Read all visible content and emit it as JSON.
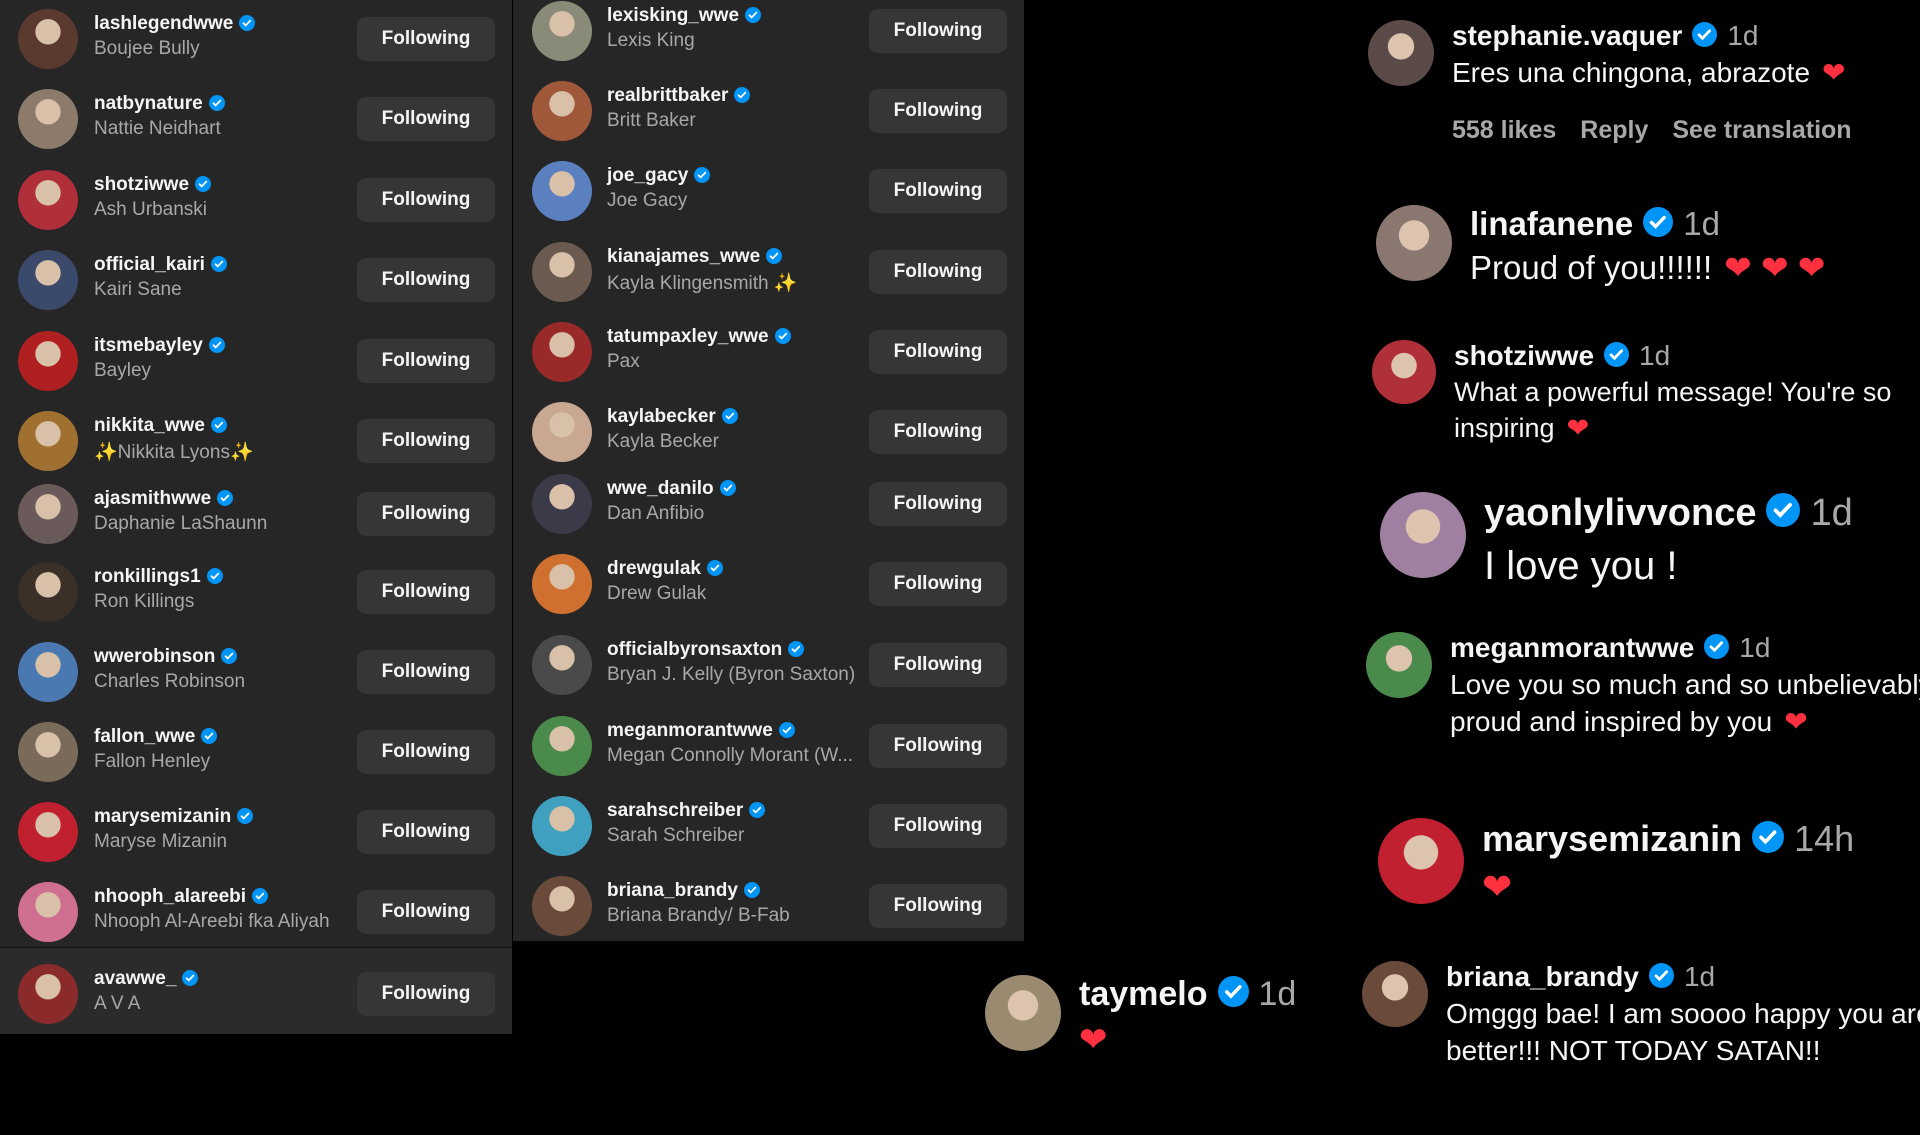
{
  "following_list_1": [
    {
      "username": "lashlegendwwe",
      "name": "Boujee Bully",
      "button": "Following",
      "color": "#5a3a2e"
    },
    {
      "username": "natbynature",
      "name": "Nattie Neidhart",
      "button": "Following",
      "color": "#8c7a6a"
    },
    {
      "username": "shotziwwe",
      "name": "Ash Urbanski",
      "button": "Following",
      "color": "#b0303a"
    },
    {
      "username": "official_kairi",
      "name": "Kairi Sane",
      "button": "Following",
      "color": "#3b4a6a"
    },
    {
      "username": "itsmebayley",
      "name": "Bayley",
      "button": "Following",
      "color": "#b02020"
    },
    {
      "username": "nikkita_wwe",
      "name": "✨Nikkita Lyons✨",
      "button": "Following",
      "color": "#a07030"
    },
    {
      "username": "ajasmithwwe",
      "name": "Daphanie LaShaunn",
      "button": "Following",
      "color": "#6a5a5a"
    },
    {
      "username": "ronkillings1",
      "name": "Ron Killings",
      "button": "Following",
      "color": "#3a3028"
    },
    {
      "username": "wwerobinson",
      "name": "Charles Robinson",
      "button": "Following",
      "color": "#4a78b0"
    },
    {
      "username": "fallon_wwe",
      "name": "Fallon Henley",
      "button": "Following",
      "color": "#7a6a5a"
    },
    {
      "username": "marysemizanin",
      "name": "Maryse Mizanin",
      "button": "Following",
      "color": "#c02030"
    },
    {
      "username": "nhooph_alareebi",
      "name": "Nhooph Al-Areebi fka Aliyah",
      "button": "Following",
      "color": "#d07090"
    },
    {
      "username": "avawwe_",
      "name": "A V A",
      "button": "Following",
      "color": "#8a2a2a"
    }
  ],
  "following_list_2": [
    {
      "username": "lexisking_wwe",
      "name": "Lexis King",
      "button": "Following",
      "color": "#8a8a78"
    },
    {
      "username": "realbrittbaker",
      "name": "Britt Baker",
      "button": "Following",
      "color": "#a0583a"
    },
    {
      "username": "joe_gacy",
      "name": "Joe Gacy",
      "button": "Following",
      "color": "#5a80c0"
    },
    {
      "username": "kianajames_wwe",
      "name": "Kayla Klingensmith ✨",
      "button": "Following",
      "color": "#6a5a50"
    },
    {
      "username": "tatumpaxley_wwe",
      "name": "Pax",
      "button": "Following",
      "color": "#9a2a2a"
    },
    {
      "username": "kaylabecker",
      "name": "Kayla Becker",
      "button": "Following",
      "color": "#c8a890"
    },
    {
      "username": "wwe_danilo",
      "name": "Dan Anfibio",
      "button": "Following",
      "color": "#3a3a48"
    },
    {
      "username": "drewgulak",
      "name": "Drew Gulak",
      "button": "Following",
      "color": "#d07030"
    },
    {
      "username": "officialbyronsaxton",
      "name": "Bryan J. Kelly (Byron Saxton)",
      "button": "Following",
      "color": "#4a4a4a"
    },
    {
      "username": "meganmorantwwe",
      "name": "Megan Connolly Morant (W...",
      "button": "Following",
      "color": "#4a8a4a"
    },
    {
      "username": "sarahschreiber",
      "name": "Sarah Schreiber",
      "button": "Following",
      "color": "#40a0c0"
    },
    {
      "username": "briana_brandy",
      "name": "Briana Brandy/ B-Fab",
      "button": "Following",
      "color": "#6a4a3a"
    }
  ],
  "comments": [
    {
      "username": "stephanie.vaquer",
      "time": "1d",
      "text": "Eres una chingona, abrazote",
      "heart": "❤",
      "color": "#5a4a48",
      "actions": {
        "likes": "558 likes",
        "reply": "Reply",
        "translate": "See translation"
      }
    },
    {
      "username": "linafanene",
      "time": "1d",
      "text": "Proud of you!!!!!!",
      "heart": "❤ ❤ ❤",
      "color": "#8a7870"
    },
    {
      "username": "shotziwwe",
      "time": "1d",
      "text": "What a powerful message! You're so inspiring",
      "heart": "❤",
      "color": "#b0303a"
    },
    {
      "username": "yaonlylivvonce",
      "time": "1d",
      "text": "I love you !",
      "heart": "",
      "color": "#a080a0"
    },
    {
      "username": "meganmorantwwe",
      "time": "1d",
      "text": "Love you so much and so unbelievably proud and inspired by you",
      "heart": "❤",
      "color": "#4a8a4a"
    },
    {
      "username": "marysemizanin",
      "time": "14h",
      "text": "",
      "heart": "❤",
      "color": "#c02030"
    },
    {
      "username": "taymelo",
      "time": "1d",
      "text": "",
      "heart": "❤",
      "color": "#9a8a70"
    },
    {
      "username": "briana_brandy",
      "time": "1d",
      "text": "Omggg bae! I am soooo happy you are better!!! NOT TODAY SATAN!!",
      "heart": "",
      "color": "#6a4a3a"
    }
  ]
}
